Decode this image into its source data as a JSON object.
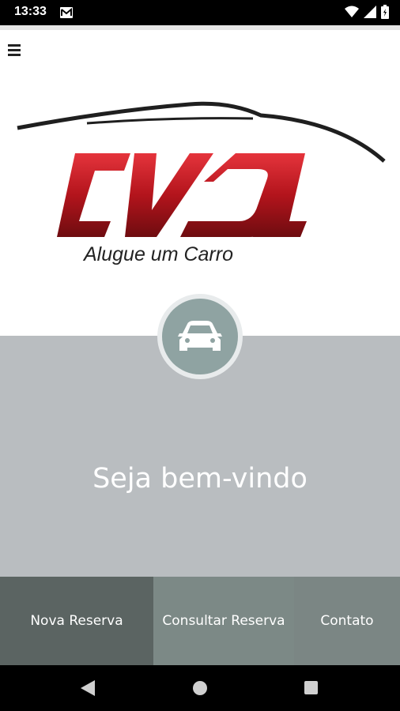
{
  "status_bar": {
    "time": "13:33",
    "icons": [
      "mail-icon",
      "wifi-icon",
      "signal-icon",
      "battery-icon"
    ]
  },
  "header": {
    "menu_icon": "hamburger-menu-icon"
  },
  "logo": {
    "wordmark": "CVDL",
    "tagline": "Alugue um Carro",
    "colors": {
      "brand_red": "#b3141c",
      "dark": "#1f1f1f"
    }
  },
  "hero": {
    "icon": "car-icon",
    "welcome_text": "Seja bem-vindo",
    "background": "#b9bdc0"
  },
  "tabs": [
    {
      "label": "Nova Reserva"
    },
    {
      "label": "Consultar Reserva"
    },
    {
      "label": "Contato"
    }
  ],
  "nav_bar": {
    "icons": [
      "back-icon",
      "home-icon",
      "recents-icon"
    ]
  }
}
